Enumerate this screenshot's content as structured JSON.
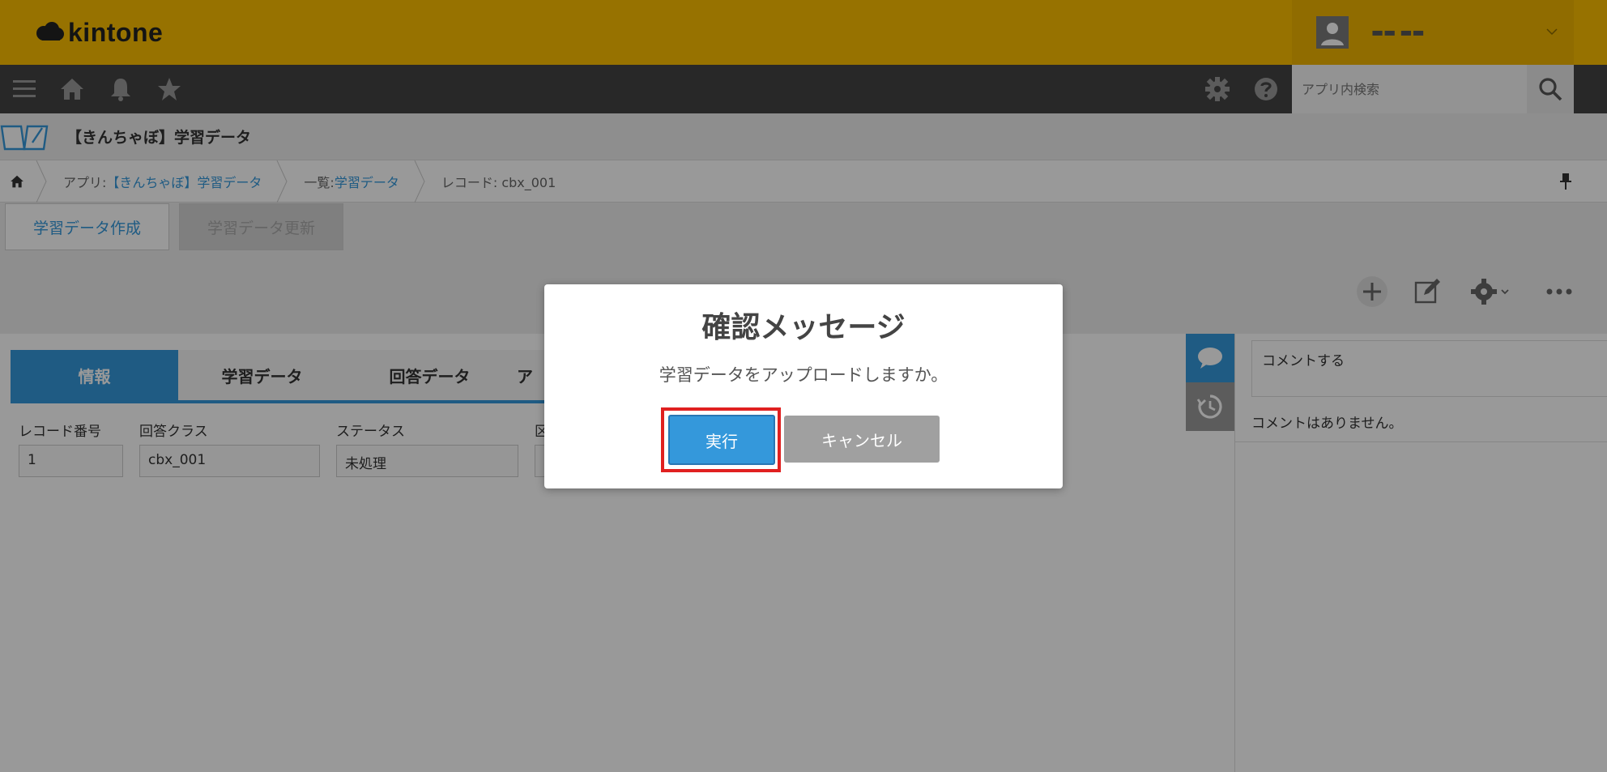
{
  "header": {
    "logo_text": "kintone",
    "user_name": "▬▬ ▬▬",
    "brand_color": "#fcbf00"
  },
  "nav": {
    "search_placeholder": "アプリ内検索",
    "icons": [
      "menu-icon",
      "home-icon",
      "bell-icon",
      "star-icon",
      "gear-icon",
      "help-icon",
      "search-icon"
    ]
  },
  "app": {
    "title": "【きんちゃぼ】学習データ"
  },
  "breadcrumb": {
    "app_prefix": "アプリ: ",
    "app_link": "【きんちゃぼ】学習データ",
    "list_prefix": "一覧: ",
    "list_link": "学習データ",
    "record": "レコード: cbx_001"
  },
  "actions": {
    "create_label": "学習データ作成",
    "update_label": "学習データ更新"
  },
  "tabs": [
    {
      "label": "情報"
    },
    {
      "label": "学習データ"
    },
    {
      "label": "回答データ"
    },
    {
      "label": "ア"
    }
  ],
  "fields": [
    {
      "label": "レコード番号",
      "value": "1"
    },
    {
      "label": "回答クラス",
      "value": "cbx_001"
    },
    {
      "label": "ステータス",
      "value": "未処理"
    },
    {
      "label": "区",
      "value": ""
    }
  ],
  "comments": {
    "input_placeholder": "コメントする",
    "empty_text": "コメントはありません。"
  },
  "dialog": {
    "title": "確認メッセージ",
    "message": "学習データをアップロードしますか。",
    "confirm_label": "実行",
    "cancel_label": "キャンセル",
    "accent_color": "#3498db",
    "highlight_color": "#e02020"
  }
}
